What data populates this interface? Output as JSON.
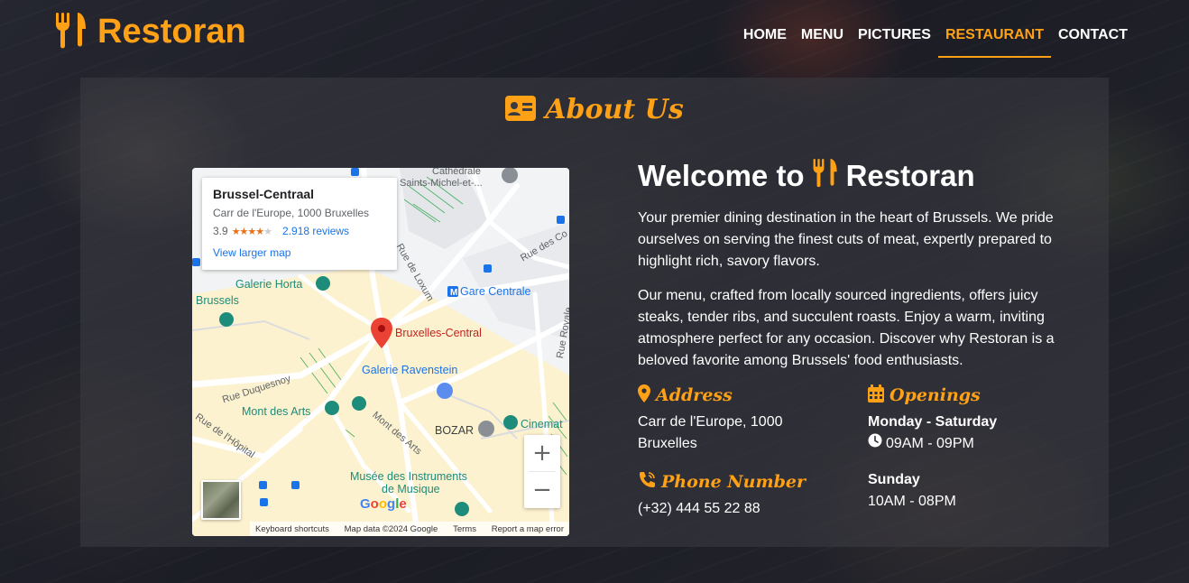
{
  "brand": {
    "name": "Restoran",
    "icon": "utensils-icon",
    "accent": "#fea116"
  },
  "nav": {
    "items": [
      {
        "label": "HOME",
        "active": false
      },
      {
        "label": "MENU",
        "active": false
      },
      {
        "label": "PICTURES",
        "active": false
      },
      {
        "label": "RESTAURANT",
        "active": true
      },
      {
        "label": "CONTACT",
        "active": false
      }
    ]
  },
  "about": {
    "title": "About Us",
    "icon": "address-card-icon"
  },
  "map": {
    "card": {
      "title": "Brussel-Centraal",
      "address": "Carr de l'Europe, 1000 Bruxelles",
      "rating": "3.9",
      "stars": 4,
      "reviews": "2.918 reviews",
      "link": "View larger map"
    },
    "labels": {
      "cathedrale1": "Cathédrale",
      "cathedrale2": "Saints-Michel-et-...",
      "rue_loxum": "Rue de Loxum",
      "rue_des_co": "Rue des Co",
      "galerie_horta": "Galerie Horta",
      "brussels": "Brussels",
      "gare_centrale": "Gare Centrale",
      "bruxelles_central": "Bruxelles-Central",
      "galerie_ravenstein": "Galerie Ravenstein",
      "rue_duquesnoy": "Rue Duquesnoy",
      "mont_des_arts": "Mont des Arts",
      "mont_des_arts_street": "Mont des Arts",
      "rue_hopital": "Rue de l'Hôpital",
      "bozar": "BOZAR",
      "cinema": "Cinemat",
      "rue_royale": "Rue Royale",
      "musee1": "Musée des Instruments",
      "musee2": "de Musique"
    },
    "zoom_in": "+",
    "zoom_out": "−",
    "google": "Google",
    "footer": {
      "shortcuts": "Keyboard shortcuts",
      "data": "Map data ©2024 Google",
      "terms": "Terms",
      "report": "Report a map error"
    }
  },
  "welcome": {
    "prefix": "Welcome to",
    "name": "Restoran"
  },
  "paragraphs": [
    "Your premier dining destination in the heart of Brussels. We pride ourselves on serving the finest cuts of meat, expertly prepared to highlight rich, savory flavors.",
    "Our menu, crafted from locally sourced ingredients, offers juicy steaks, tender ribs, and succulent roasts. Enjoy a warm, inviting atmosphere perfect for any occasion. Discover why Restoran is a beloved favorite among Brussels' food enthusiasts."
  ],
  "address": {
    "title": "Address",
    "icon": "map-marker-icon",
    "line1": "Carr de l'Europe, 1000",
    "line2": "Bruxelles"
  },
  "phone": {
    "title": "Phone Number",
    "icon": "phone-icon",
    "value": "(+32) 444 55 22 88"
  },
  "openings": {
    "title": "Openings",
    "icon": "calendar-icon",
    "weekdays_label": "Monday - Saturday",
    "weekdays_hours": "09AM - 09PM",
    "sunday_label": "Sunday",
    "sunday_hours": "10AM - 08PM"
  }
}
